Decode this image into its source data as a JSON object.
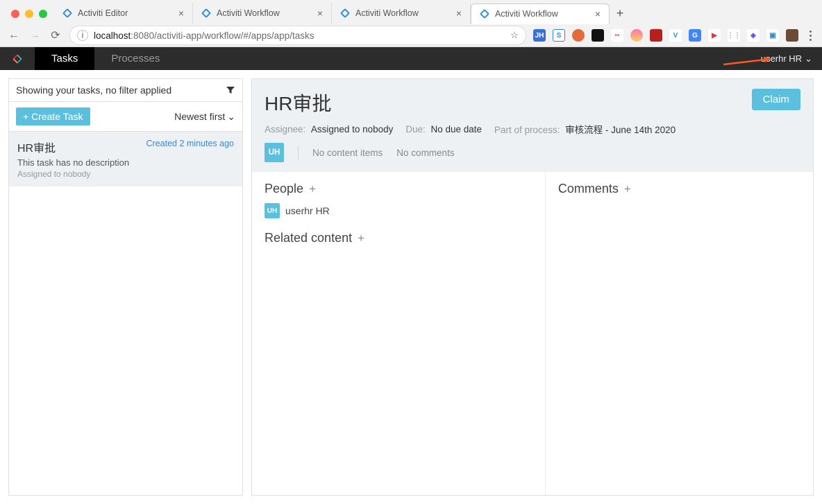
{
  "browser": {
    "tabs": [
      {
        "title": "Activiti Editor",
        "active": false
      },
      {
        "title": "Activiti Workflow",
        "active": false
      },
      {
        "title": "Activiti Workflow",
        "active": false
      },
      {
        "title": "Activiti Workflow",
        "active": true
      }
    ],
    "url_host": "localhost",
    "url_port": ":8080",
    "url_path": "/activiti-app/workflow/#/apps/app/tasks"
  },
  "app": {
    "nav": {
      "tasks": "Tasks",
      "processes": "Processes"
    },
    "user": "userhr HR"
  },
  "left": {
    "filter_text": "Showing your tasks, no filter applied",
    "create_label": "+ Create Task",
    "sort_label": "Newest first",
    "task": {
      "title": "HR审批",
      "meta": "Created 2 minutes ago",
      "desc": "This task has no description",
      "assign": "Assigned to nobody"
    }
  },
  "detail": {
    "title": "HR审批",
    "claim_label": "Claim",
    "assignee_lbl": "Assignee:",
    "assignee_val": "Assigned to nobody",
    "due_lbl": "Due:",
    "due_val": "No due date",
    "process_lbl": "Part of process:",
    "process_val": "审核流程 - June 14th 2020",
    "avatar_initials": "UH",
    "no_content": "No content items",
    "no_comments": "No comments",
    "people_label": "People",
    "person_initials": "UH",
    "person_name": "userhr HR",
    "related_label": "Related content",
    "comments_label": "Comments"
  }
}
